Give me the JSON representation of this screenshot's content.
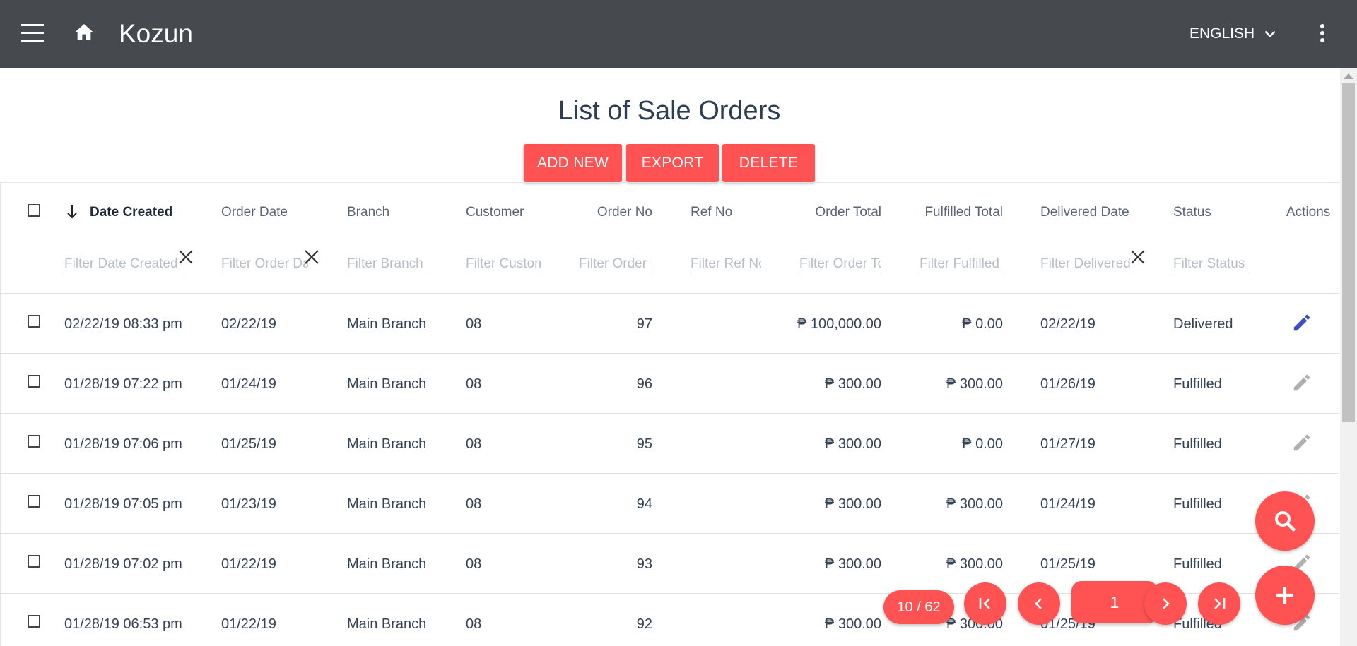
{
  "appbar": {
    "title": "Kozun",
    "language": "ENGLISH"
  },
  "page": {
    "title": "List of Sale Orders"
  },
  "actions": {
    "add_new": "ADD NEW",
    "export": "EXPORT",
    "delete": "DELETE"
  },
  "table": {
    "sorted_column": "Date Created",
    "sort_direction": "descending",
    "columns": {
      "date_created": "Date Created",
      "order_date": "Order Date",
      "branch": "Branch",
      "customer": "Customer",
      "order_no": "Order No",
      "ref_no": "Ref No",
      "order_total": "Order Total",
      "fulfilled_total": "Fulfilled Total",
      "delivered_date": "Delivered Date",
      "status": "Status",
      "actions": "Actions"
    },
    "filters": {
      "date_created": "Filter Date Created",
      "order_date": "Filter Order Date",
      "branch": "Filter Branch",
      "customer": "Filter Customer",
      "order_no": "Filter Order No",
      "ref_no": "Filter Ref No",
      "order_total": "Filter Order Total",
      "fulfilled_total": "Filter Fulfilled Total",
      "delivered_date": "Filter Delivered Date",
      "status": "Filter Status"
    },
    "rows": [
      {
        "date_created": "02/22/19 08:33 pm",
        "order_date": "02/22/19",
        "branch": "Main Branch",
        "customer": "08",
        "order_no": "97",
        "ref_no": "",
        "order_total": "₱ 100,000.00",
        "fulfilled_total": "₱ 0.00",
        "delivered_date": "02/22/19",
        "status": "Delivered",
        "editable": true
      },
      {
        "date_created": "01/28/19 07:22 pm",
        "order_date": "01/24/19",
        "branch": "Main Branch",
        "customer": "08",
        "order_no": "96",
        "ref_no": "",
        "order_total": "₱ 300.00",
        "fulfilled_total": "₱ 300.00",
        "delivered_date": "01/26/19",
        "status": "Fulfilled",
        "editable": false
      },
      {
        "date_created": "01/28/19 07:06 pm",
        "order_date": "01/25/19",
        "branch": "Main Branch",
        "customer": "08",
        "order_no": "95",
        "ref_no": "",
        "order_total": "₱ 300.00",
        "fulfilled_total": "₱ 0.00",
        "delivered_date": "01/27/19",
        "status": "Fulfilled",
        "editable": false
      },
      {
        "date_created": "01/28/19 07:05 pm",
        "order_date": "01/23/19",
        "branch": "Main Branch",
        "customer": "08",
        "order_no": "94",
        "ref_no": "",
        "order_total": "₱ 300.00",
        "fulfilled_total": "₱ 300.00",
        "delivered_date": "01/24/19",
        "status": "Fulfilled",
        "editable": false
      },
      {
        "date_created": "01/28/19 07:02 pm",
        "order_date": "01/22/19",
        "branch": "Main Branch",
        "customer": "08",
        "order_no": "93",
        "ref_no": "",
        "order_total": "₱ 300.00",
        "fulfilled_total": "₱ 300.00",
        "delivered_date": "01/25/19",
        "status": "Fulfilled",
        "editable": false
      },
      {
        "date_created": "01/28/19 06:53 pm",
        "order_date": "01/22/19",
        "branch": "Main Branch",
        "customer": "08",
        "order_no": "92",
        "ref_no": "",
        "order_total": "₱ 300.00",
        "fulfilled_total": "₱ 300.00",
        "delivered_date": "01/25/19",
        "status": "Fulfilled",
        "editable": false
      }
    ]
  },
  "pagination": {
    "page_info": "10 / 62",
    "current_page": "1"
  },
  "colors": {
    "appbar": "#46494e",
    "accent": "#ff5252",
    "edit_active": "#3f51b5",
    "edit_disabled": "#b0b0b0"
  },
  "icons": {
    "menu": "menu-icon",
    "home": "home-icon",
    "language_toggle": "chevron-down-icon",
    "more": "more-vert-icon",
    "sort": "arrow-down-icon",
    "clear": "close-icon",
    "edit": "pencil-icon",
    "search": "search-icon",
    "add": "plus-icon",
    "first_page": "first-page-icon",
    "prev_page": "chevron-left-icon",
    "next_page": "chevron-right-icon",
    "last_page": "last-page-icon"
  }
}
